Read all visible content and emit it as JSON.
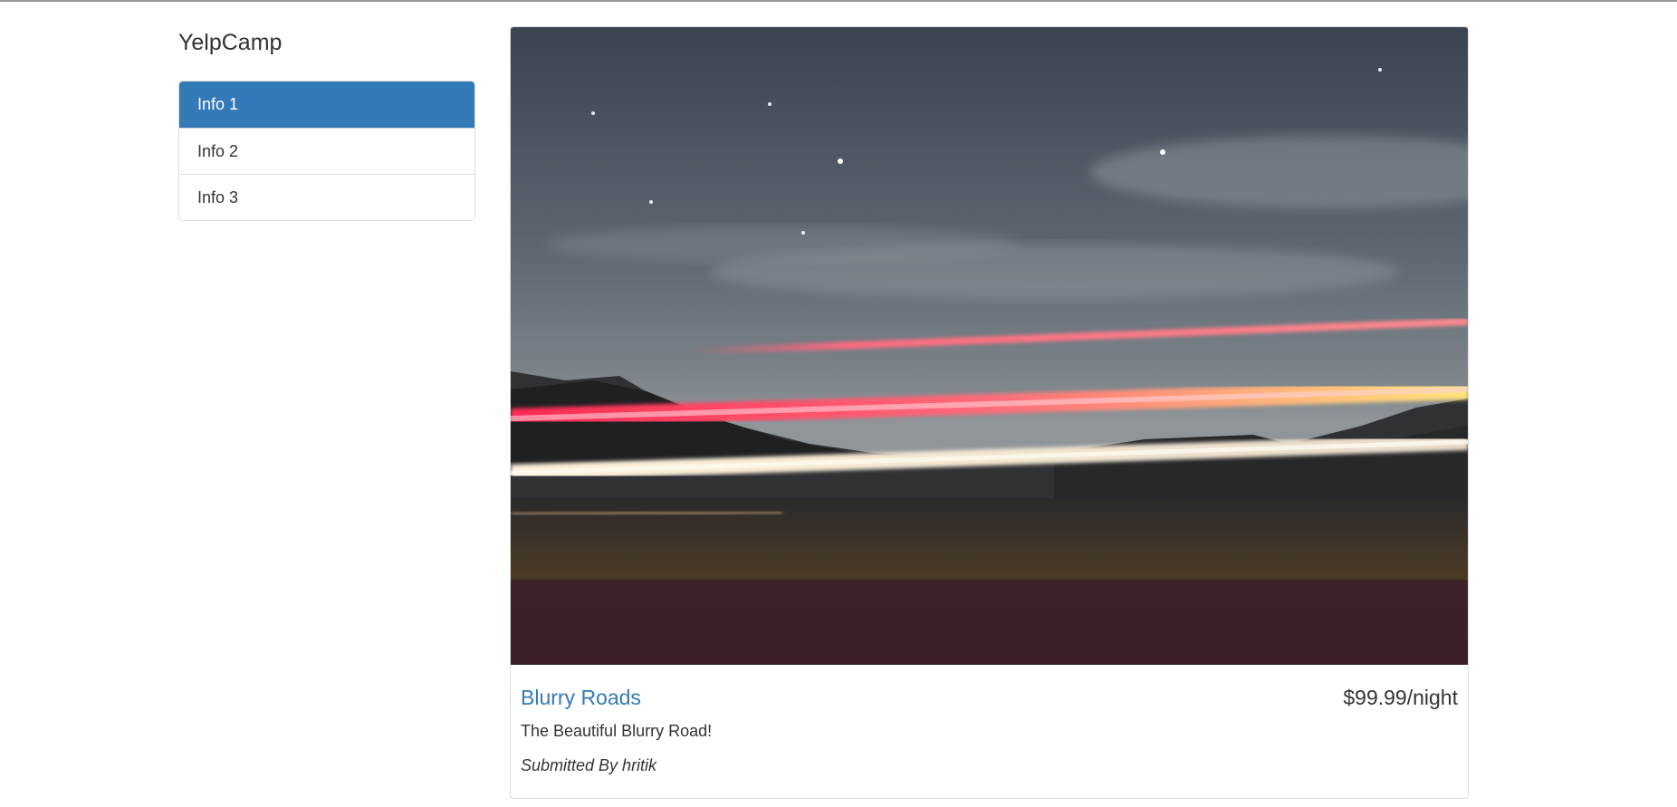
{
  "brand": "YelpCamp",
  "sidebar": {
    "items": [
      {
        "label": "Info 1",
        "active": true
      },
      {
        "label": "Info 2",
        "active": false
      },
      {
        "label": "Info 3",
        "active": false
      }
    ]
  },
  "campground": {
    "name": "Blurry Roads",
    "price": "$99.99/night",
    "description": "The Beautiful Blurry Road!",
    "submitted_by": "Submitted By hritik",
    "image_subject": "night-road-light-trails-photo"
  },
  "colors": {
    "accent": "#337ab7",
    "text": "#333333",
    "border": "#dddddd"
  }
}
